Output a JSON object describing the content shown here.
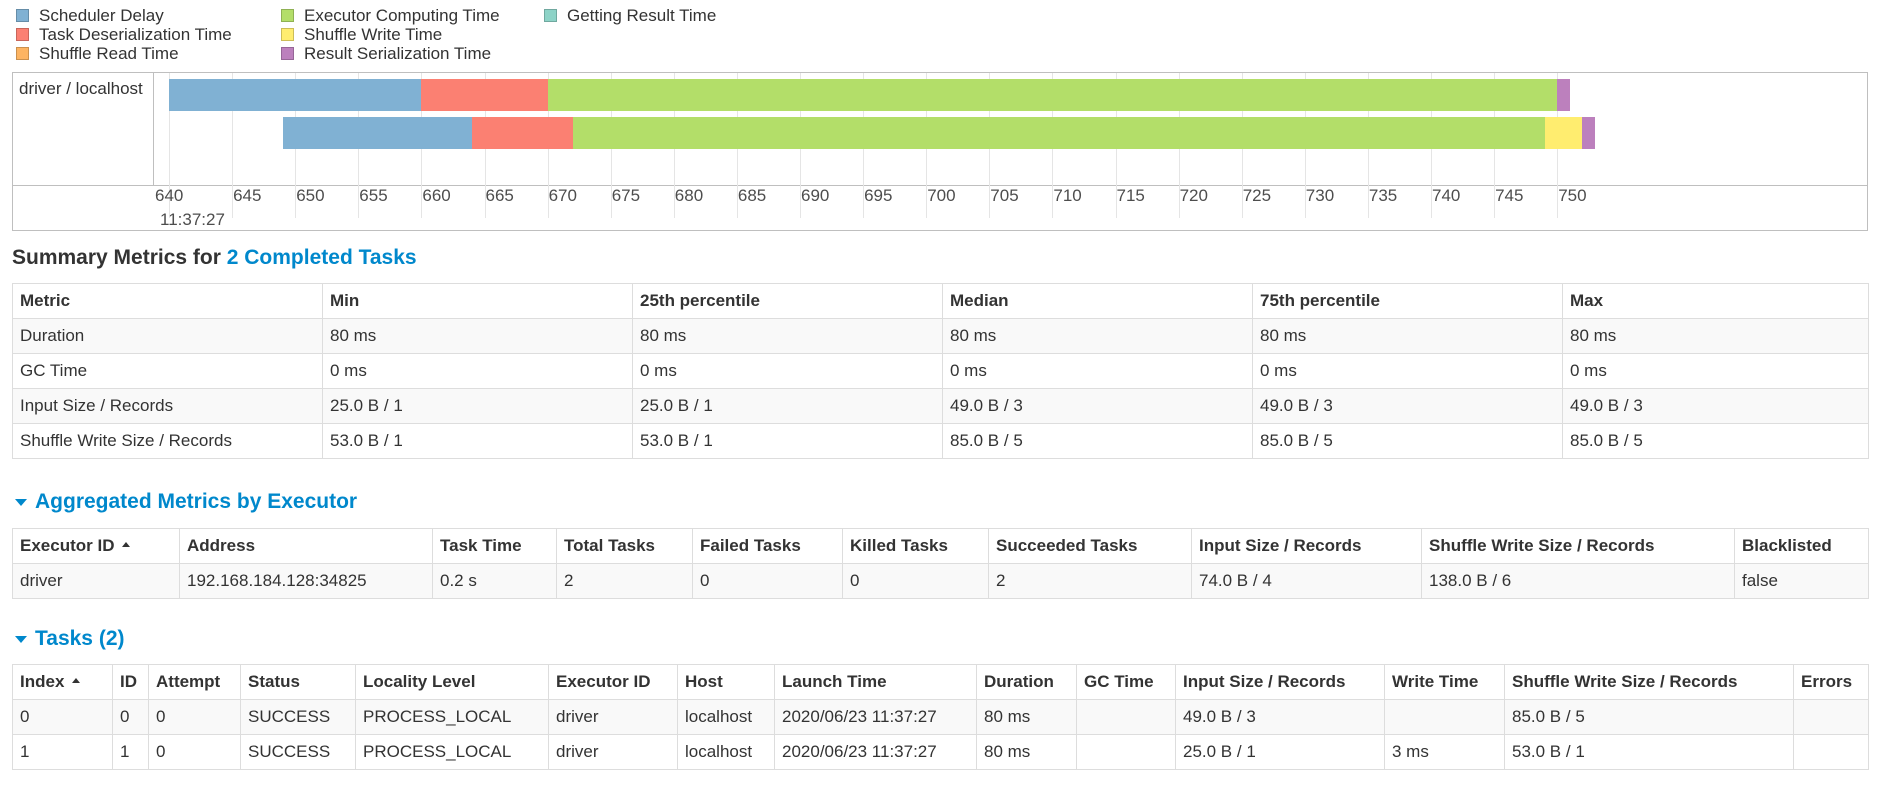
{
  "legend": {
    "items": [
      {
        "label": "Scheduler Delay",
        "color": "#80b1d3"
      },
      {
        "label": "Task Deserialization Time",
        "color": "#fb8072"
      },
      {
        "label": "Shuffle Read Time",
        "color": "#fdb462"
      },
      {
        "label": "Executor Computing Time",
        "color": "#b3de69"
      },
      {
        "label": "Shuffle Write Time",
        "color": "#ffed6f"
      },
      {
        "label": "Result Serialization Time",
        "color": "#bc80bd"
      },
      {
        "label": "Getting Result Time",
        "color": "#8dd3c7"
      }
    ]
  },
  "timeline": {
    "group_label": "driver / localhost",
    "tick_labels": [
      "640",
      "645",
      "650",
      "655",
      "660",
      "665",
      "670",
      "675",
      "680",
      "685",
      "690",
      "695",
      "700",
      "705",
      "710",
      "715",
      "720",
      "725",
      "730",
      "735",
      "740",
      "745",
      "750"
    ],
    "time_label": "11:37:27",
    "tasks": [
      {
        "start": 640,
        "segments": [
          {
            "phase": "scheduler_delay",
            "ms": 20,
            "color": "#80b1d3"
          },
          {
            "phase": "task_deserialization",
            "ms": 10,
            "color": "#fb8072"
          },
          {
            "phase": "executor_computing",
            "ms": 80,
            "color": "#b3de69"
          },
          {
            "phase": "result_serialization",
            "ms": 1,
            "color": "#bc80bd"
          }
        ]
      },
      {
        "start": 649,
        "segments": [
          {
            "phase": "scheduler_delay",
            "ms": 15,
            "color": "#80b1d3"
          },
          {
            "phase": "task_deserialization",
            "ms": 8,
            "color": "#fb8072"
          },
          {
            "phase": "executor_computing",
            "ms": 77,
            "color": "#b3de69"
          },
          {
            "phase": "shuffle_write",
            "ms": 3,
            "color": "#ffed6f"
          },
          {
            "phase": "result_serialization",
            "ms": 1,
            "color": "#bc80bd"
          }
        ]
      }
    ]
  },
  "summary": {
    "title_prefix": "Summary Metrics for ",
    "title_link": "2 Completed Tasks",
    "headers": [
      "Metric",
      "Min",
      "25th percentile",
      "Median",
      "75th percentile",
      "Max"
    ],
    "rows": [
      [
        "Duration",
        "80 ms",
        "80 ms",
        "80 ms",
        "80 ms",
        "80 ms"
      ],
      [
        "GC Time",
        "0 ms",
        "0 ms",
        "0 ms",
        "0 ms",
        "0 ms"
      ],
      [
        "Input Size / Records",
        "25.0 B / 1",
        "25.0 B / 1",
        "49.0 B / 3",
        "49.0 B / 3",
        "49.0 B / 3"
      ],
      [
        "Shuffle Write Size / Records",
        "53.0 B / 1",
        "53.0 B / 1",
        "85.0 B / 5",
        "85.0 B / 5",
        "85.0 B / 5"
      ]
    ]
  },
  "aggregated": {
    "title": "Aggregated Metrics by Executor",
    "headers": [
      "Executor ID",
      "Address",
      "Task Time",
      "Total Tasks",
      "Failed Tasks",
      "Killed Tasks",
      "Succeeded Tasks",
      "Input Size / Records",
      "Shuffle Write Size / Records",
      "Blacklisted"
    ],
    "rows": [
      [
        "driver",
        "192.168.184.128:34825",
        "0.2 s",
        "2",
        "0",
        "0",
        "2",
        "74.0 B / 4",
        "138.0 B / 6",
        "false"
      ]
    ]
  },
  "tasks": {
    "title": "Tasks (2)",
    "headers": [
      "Index",
      "ID",
      "Attempt",
      "Status",
      "Locality Level",
      "Executor ID",
      "Host",
      "Launch Time",
      "Duration",
      "GC Time",
      "Input Size / Records",
      "Write Time",
      "Shuffle Write Size / Records",
      "Errors"
    ],
    "rows": [
      [
        "0",
        "0",
        "0",
        "SUCCESS",
        "PROCESS_LOCAL",
        "driver",
        "localhost",
        "2020/06/23 11:37:27",
        "80 ms",
        "",
        "49.0 B / 3",
        "",
        "85.0 B / 5",
        ""
      ],
      [
        "1",
        "1",
        "0",
        "SUCCESS",
        "PROCESS_LOCAL",
        "driver",
        "localhost",
        "2020/06/23 11:37:27",
        "80 ms",
        "",
        "25.0 B / 1",
        "3 ms",
        "53.0 B / 1",
        ""
      ]
    ]
  }
}
